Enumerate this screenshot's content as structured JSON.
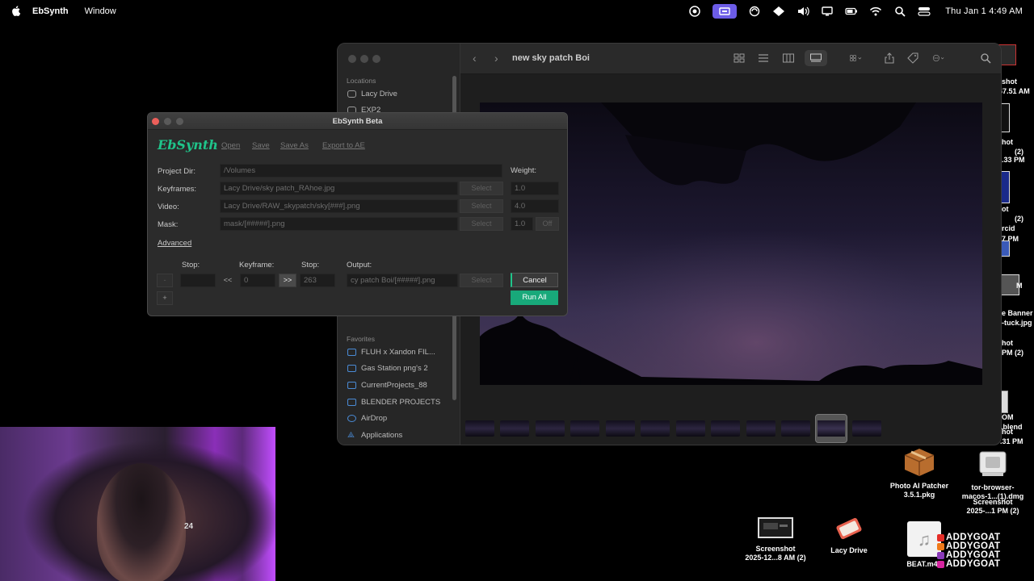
{
  "menubar": {
    "app_name": "EbSynth",
    "menu_window": "Window",
    "clock": "Thu Jan 1  4:49 AM",
    "status_icons": [
      "creative-cloud-icon",
      "screen-share-icon",
      "cc-sync-icon",
      "diamond-icon",
      "volume-icon",
      "display-icon",
      "battery-icon",
      "wifi-icon",
      "search-icon",
      "control-center-icon"
    ]
  },
  "finder": {
    "title": "new sky patch Boi",
    "locations_header": "Locations",
    "locations": [
      "Lacy Drive",
      "EXP2"
    ],
    "favorites_header": "Favorites",
    "favorites": [
      "FLUH x Xandon FIL...",
      "Gas Station png's 2",
      "CurrentProjects_88",
      "BLENDER PROJECTS",
      "AirDrop",
      "Applications"
    ]
  },
  "ebsynth": {
    "window_title": "EbSynth Beta",
    "logo": "EbSynth",
    "menu": {
      "open": "Open",
      "save": "Save",
      "save_as": "Save As",
      "export": "Export to AE"
    },
    "project_dir_label": "Project Dir:",
    "project_dir_value": "/Volumes",
    "weight_label": "Weight:",
    "keyframes_label": "Keyframes:",
    "keyframes_value": "Lacy Drive/sky patch_RAhoe.jpg",
    "keyframes_weight": "1.0",
    "video_label": "Video:",
    "video_value": "Lacy Drive/RAW_skypatch/sky[###].png",
    "video_weight": "4.0",
    "mask_label": "Mask:",
    "mask_value": "mask/[#####].png",
    "mask_weight": "1.0",
    "mask_toggle": "Off",
    "select_label": "Select",
    "advanced": "Advanced",
    "stop_label": "Stop:",
    "keyframe_label": "Keyframe:",
    "stop2_label": "Stop:",
    "output_label": "Output:",
    "prev_btn": "<<",
    "next_btn": ">>",
    "keyframe_value": "0",
    "stop_value": "263",
    "output_value": "cy patch Boi/[#####].png",
    "minus_btn": "-",
    "plus_btn": "+",
    "cancel": "Cancel",
    "run_all": "Run All"
  },
  "desktop": {
    "items": [
      {
        "label": "Photo AI Patcher\n3.5.1.pkg"
      },
      {
        "label": "tor-browser-\nmacos-1...(1).dmg"
      },
      {
        "label": "Screenshot\n2025-12...8 AM (2)"
      },
      {
        "label": "Lacy Drive"
      },
      {
        "label": "BEAT.m4a"
      }
    ],
    "edge_labels": [
      "shot",
      "47.51 AM",
      "hot",
      "(2)",
      ".33 PM",
      "ot",
      "(2)",
      "rcid",
      "7 PM",
      "M",
      "e Banner",
      "-tuck.jpg",
      "hot",
      "PM (2)",
      "OM",
      ").blend",
      "hot",
      ".31 PM",
      "Screenshot",
      "2025-...1 PM (2)",
      "tor-browser-",
      "macos-1...(1).dmg"
    ]
  },
  "webcam": {
    "jersey_number": "24"
  },
  "watermark": [
    "ADDYGOAT",
    "ADDYGOAT",
    "ADDYGOAT",
    "ADDYGOAT"
  ],
  "colors": {
    "accent_green": "#1fc48a",
    "run_green": "#18a97a",
    "menubar_active": "#6c5ce7",
    "close_red": "#ec5f5a",
    "folder_blue": "#4a8bd6"
  }
}
